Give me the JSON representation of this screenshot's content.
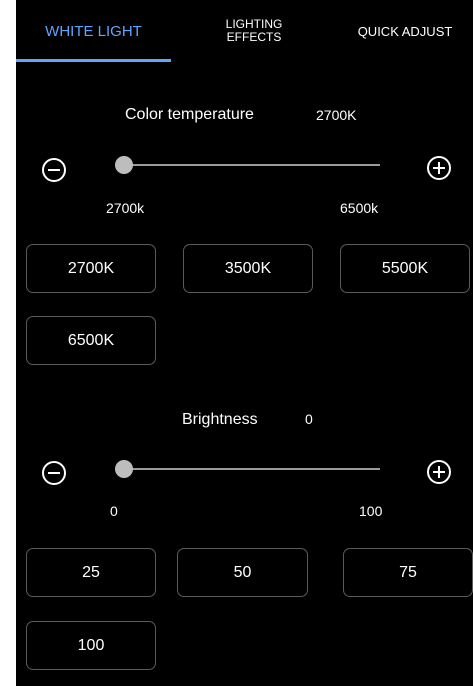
{
  "tabs": [
    {
      "label": "WHITE LIGHT",
      "active": true
    },
    {
      "label_line1": "LIGHTING",
      "label_line2": "EFFECTS",
      "active": false
    },
    {
      "label": "QUICK ADJUST",
      "active": false
    }
  ],
  "colors": {
    "accent": "#5fa5ff",
    "background": "#000000",
    "text": "#ffffff",
    "button_border": "#5a5a5a",
    "track": "#9a9a9a",
    "thumb": "#bdbdbd"
  },
  "color_temperature": {
    "label": "Color temperature",
    "value": "2700K",
    "min_label": "2700k",
    "max_label": "6500k",
    "level": 0,
    "decrease_icon": "minus-circle-icon",
    "increase_icon": "plus-circle-icon",
    "presets": [
      "2700K",
      "3500K",
      "5500K",
      "6500K"
    ]
  },
  "brightness": {
    "label": "Brightness",
    "value": "0",
    "min_label": "0",
    "max_label": "100",
    "level": 0,
    "decrease_icon": "minus-circle-icon",
    "increase_icon": "plus-circle-icon",
    "presets": [
      "25",
      "50",
      "75",
      "100"
    ]
  }
}
